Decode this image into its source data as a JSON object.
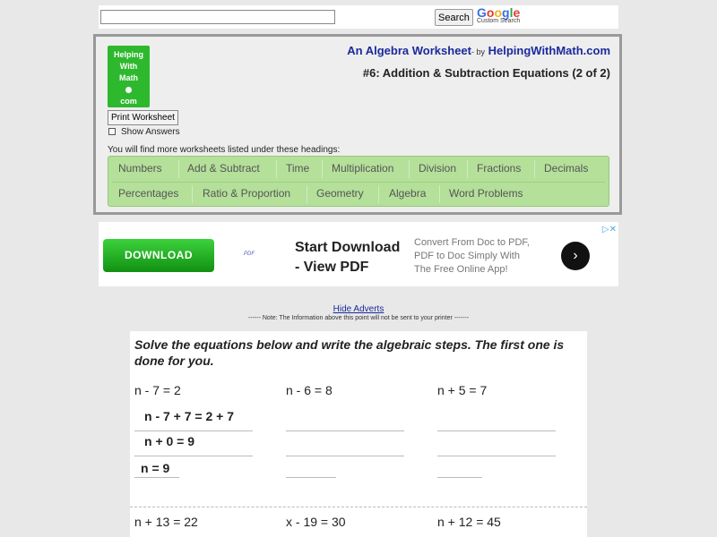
{
  "search": {
    "placeholder": "",
    "button_label": "Search",
    "google_text": "Google",
    "google_sub": "Custom Search"
  },
  "logo": {
    "line1": "Helping",
    "line2": "With",
    "line3": "Math",
    "line4": "com"
  },
  "toolbar": {
    "print_label": "Print Worksheet",
    "show_answers_label": "Show Answers"
  },
  "header": {
    "title": "An Algebra Worksheet",
    "by_text": "- by",
    "site": "HelpingWithMath.com",
    "subtitle": "#6: Addition & Subtraction Equations (2 of 2)"
  },
  "headings_note": "You will find more worksheets listed under these headings:",
  "categories_row1": [
    "Numbers",
    "Add & Subtract",
    "Time",
    "Multiplication",
    "Division",
    "Fractions",
    "Decimals"
  ],
  "categories_row2": [
    "Percentages",
    "Ratio & Proportion",
    "Geometry",
    "Algebra",
    "Word Problems"
  ],
  "ad": {
    "button_label": "DOWNLOAD",
    "brand": "PDF",
    "headline1": "Start Download",
    "headline2": "- View PDF",
    "body1": "Convert From Doc to PDF,",
    "body2": "PDF to Doc Simply With",
    "body3": "The Free Online App!",
    "arrow": "›",
    "close": "▷✕"
  },
  "notes": {
    "hide_adverts": "Hide Adverts",
    "printer_note": "------ Note: The Information above this point will not be sent to your printer -------"
  },
  "worksheet": {
    "instructions": "Solve the equations below and write the algebraic steps. The first one is done for you.",
    "problems_row1": [
      "n - 7 = 2",
      "n - 6 = 8",
      "n + 5 = 7"
    ],
    "worked_steps": [
      "n - 7 + 7 = 2 + 7",
      "n + 0 = 9",
      "n = 9"
    ],
    "problems_row2": [
      "n + 13 = 22",
      "x - 19 = 30",
      "n + 12 = 45"
    ]
  }
}
